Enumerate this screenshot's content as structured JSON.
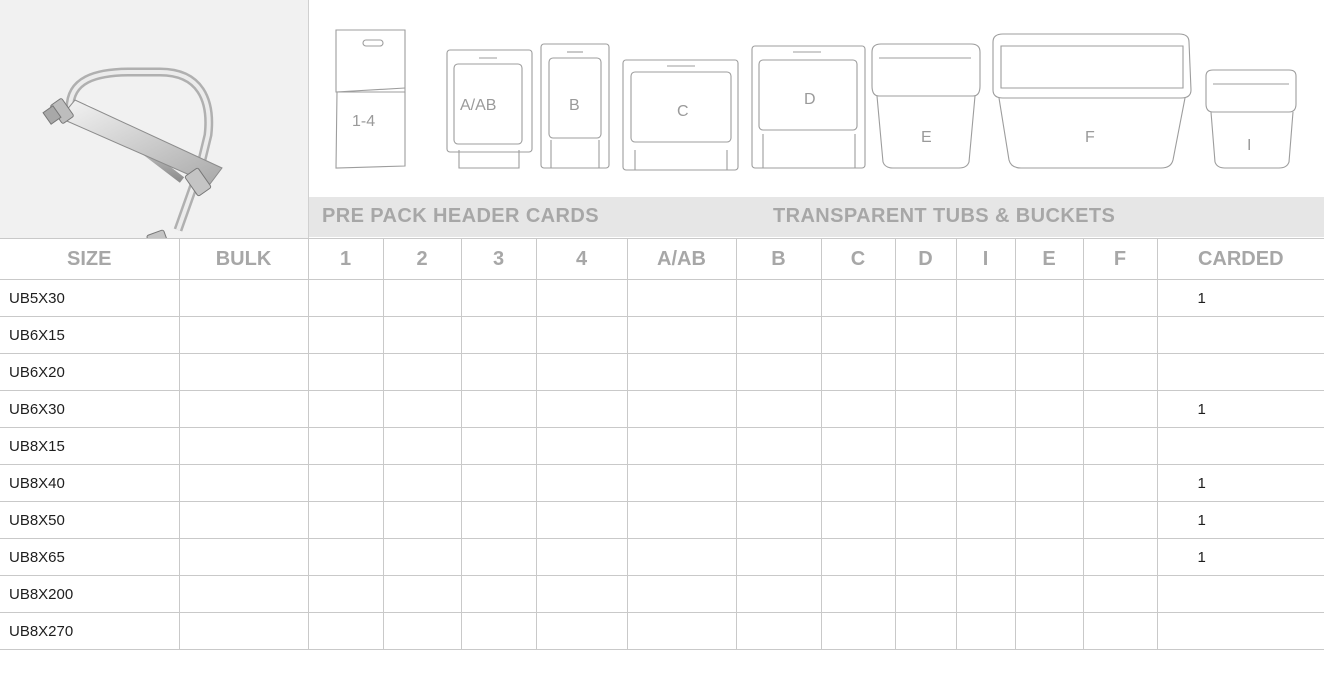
{
  "product_image": {
    "alt": "U-bolt with nuts and plate"
  },
  "pack_icons": [
    {
      "name": "pack-1-4",
      "label": "1-4"
    },
    {
      "name": "pack-a-ab",
      "label": "A/AB"
    },
    {
      "name": "pack-b",
      "label": "B"
    },
    {
      "name": "pack-c",
      "label": "C"
    },
    {
      "name": "pack-d",
      "label": "D"
    },
    {
      "name": "tub-e",
      "label": "E"
    },
    {
      "name": "bucket-f",
      "label": "F"
    },
    {
      "name": "tub-i",
      "label": "I"
    }
  ],
  "section_labels": {
    "header_cards": "PRE PACK HEADER CARDS",
    "tubs": "TRANSPARENT TUBS & BUCKETS"
  },
  "columns": [
    "SIZE",
    "BULK",
    "1",
    "2",
    "3",
    "4",
    "A/AB",
    "B",
    "C",
    "D",
    "I",
    "E",
    "F",
    "CARDED"
  ],
  "rows": [
    {
      "size": "UB5X30",
      "carded": "1"
    },
    {
      "size": "UB6X15",
      "carded": ""
    },
    {
      "size": "UB6X20",
      "carded": ""
    },
    {
      "size": "UB6X30",
      "carded": "1"
    },
    {
      "size": "UB8X15",
      "carded": ""
    },
    {
      "size": "UB8X40",
      "carded": "1"
    },
    {
      "size": "UB8X50",
      "carded": "1"
    },
    {
      "size": "UB8X65",
      "carded": "1"
    },
    {
      "size": "UB8X200",
      "carded": ""
    },
    {
      "size": "UB8X270",
      "carded": ""
    }
  ],
  "colors": {
    "header_text": "#a7a7a7",
    "band": "#e6e6e6",
    "grid_line": "#c9c9c9"
  }
}
